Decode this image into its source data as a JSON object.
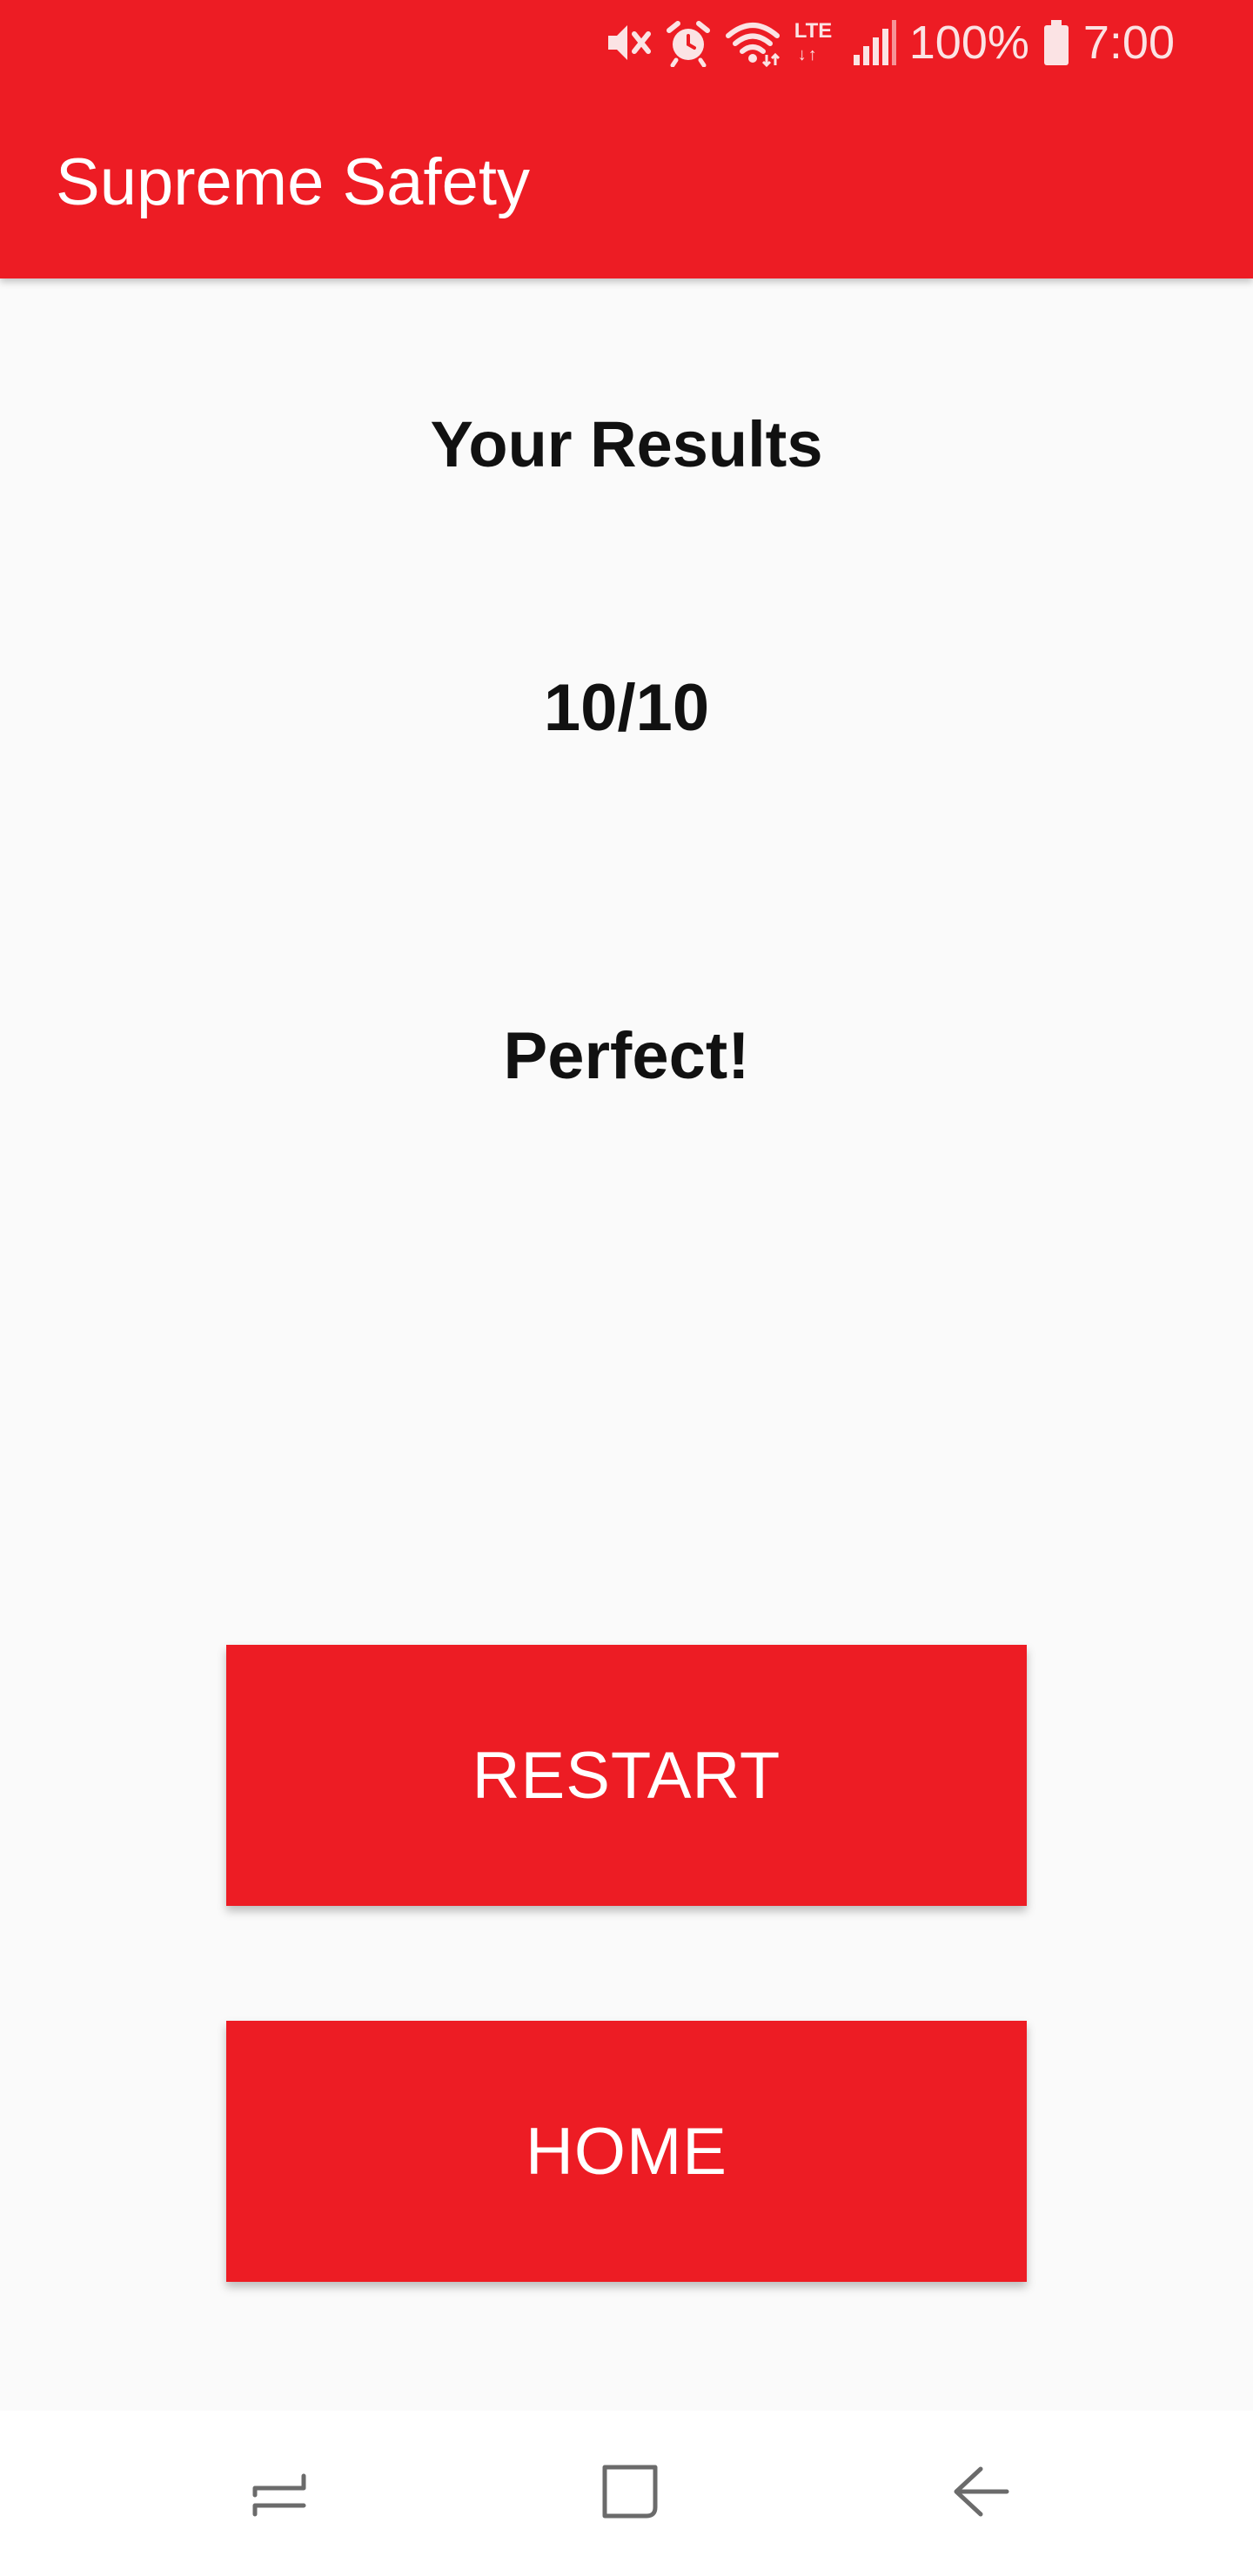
{
  "status_bar": {
    "battery": "100%",
    "time": "7:00",
    "network": "LTE",
    "icons": [
      "mute-icon",
      "alarm-icon",
      "wifi-icon",
      "lte-icon",
      "signal-icon",
      "battery-icon"
    ]
  },
  "app": {
    "title": "Supreme Safety"
  },
  "results": {
    "heading": "Your Results",
    "score": "10/10",
    "verdict": "Perfect!"
  },
  "buttons": {
    "restart_label": "RESTART",
    "home_label": "HOME"
  },
  "nav_bar": {
    "icons": [
      "recents-icon",
      "home-icon",
      "back-icon"
    ]
  },
  "colors": {
    "accent": "#ed1c24",
    "background": "#fafafa",
    "text": "#111111"
  }
}
